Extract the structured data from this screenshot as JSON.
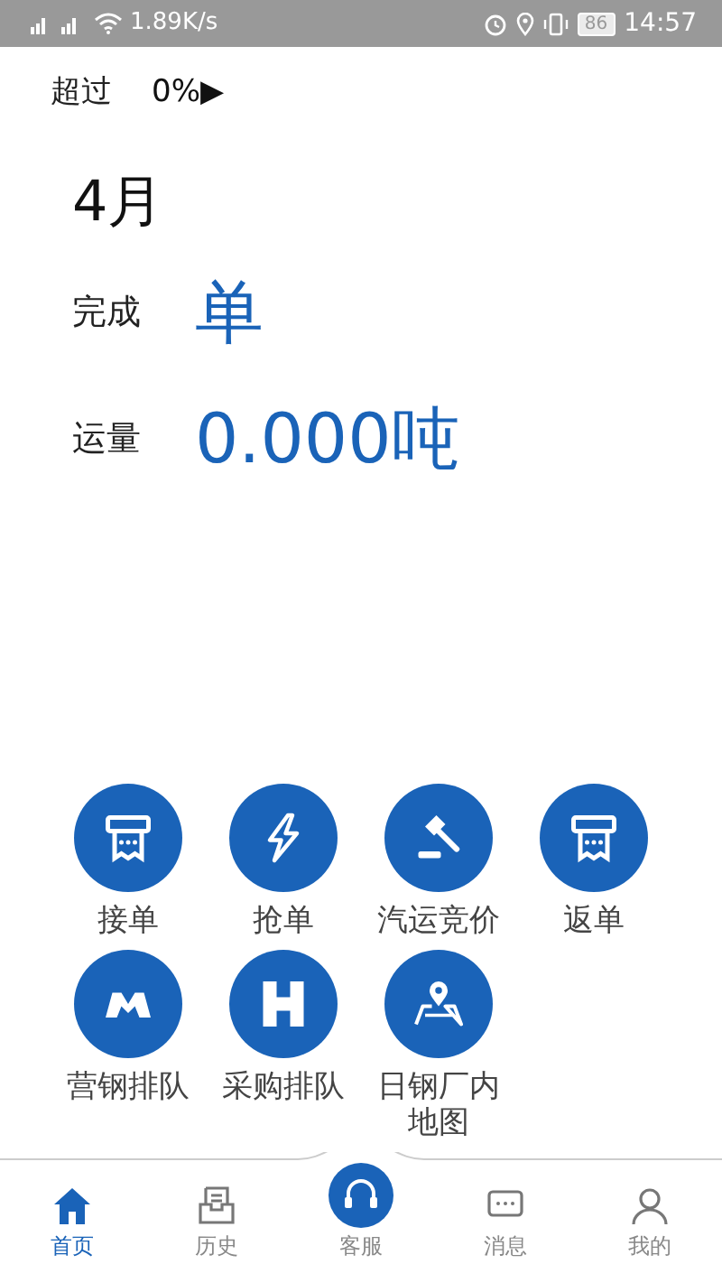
{
  "status_bar": {
    "network_speed": "1.89K/s",
    "battery": "86",
    "time": "14:57"
  },
  "header": {
    "label": "超过",
    "value": "0%▶"
  },
  "summary": {
    "month": "4月",
    "completed_label": "完成",
    "completed_value": "单",
    "volume_label": "运量",
    "volume_value": "0.000吨"
  },
  "actions": [
    {
      "label": "接单",
      "kind": "ticket"
    },
    {
      "label": "抢单",
      "kind": "bolt"
    },
    {
      "label": "汽运竞价",
      "kind": "gavel"
    },
    {
      "label": "返单",
      "kind": "ticket"
    },
    {
      "label": "营钢排队",
      "kind": "hands"
    },
    {
      "label": "采购排队",
      "kind": "letter"
    },
    {
      "label": "日钢厂内地图",
      "kind": "map"
    }
  ],
  "bottom_nav": [
    {
      "label": "首页",
      "kind": "home",
      "selected": true
    },
    {
      "label": "历史",
      "kind": "history",
      "selected": false
    },
    {
      "label": "客服",
      "kind": "service",
      "selected": false
    },
    {
      "label": "消息",
      "kind": "message",
      "selected": false
    },
    {
      "label": "我的",
      "kind": "user",
      "selected": false
    }
  ]
}
